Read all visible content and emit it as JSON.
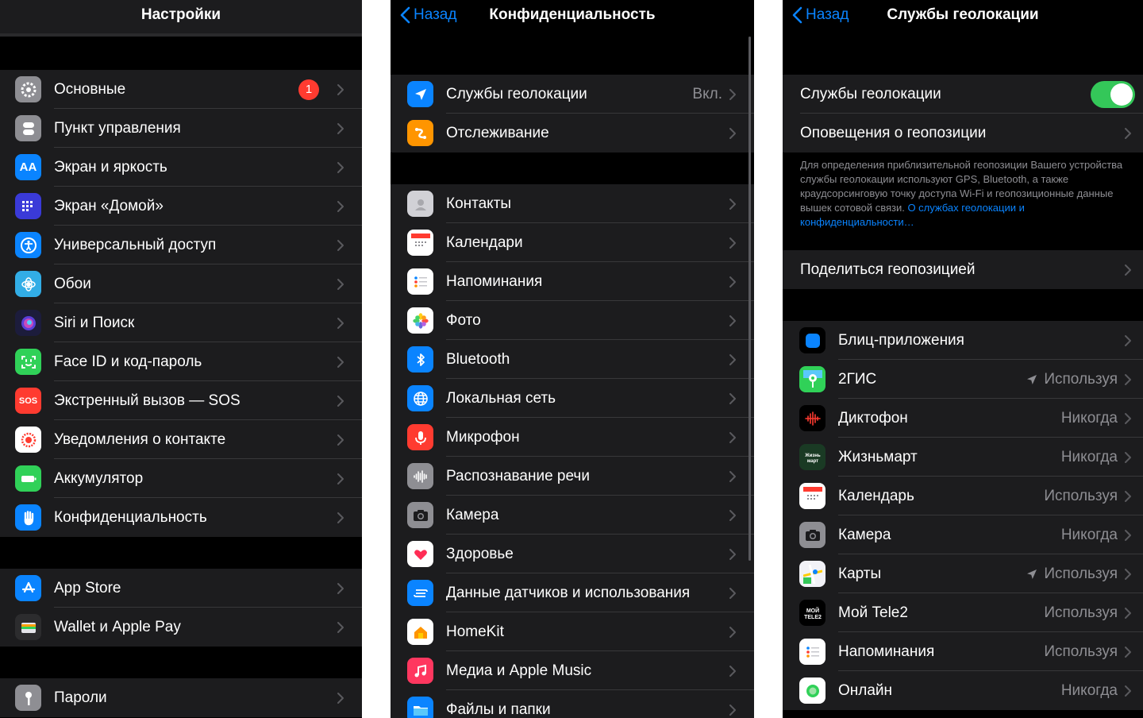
{
  "panel1": {
    "title": "Настройки",
    "group1": [
      {
        "label": "Основные",
        "icon": "gear-icon",
        "badge": "1"
      },
      {
        "label": "Пункт управления",
        "icon": "control-center-icon"
      },
      {
        "label": "Экран и яркость",
        "icon": "display-icon",
        "glyph": "AA"
      },
      {
        "label": "Экран «Домой»",
        "icon": "home-screen-icon"
      },
      {
        "label": "Универсальный доступ",
        "icon": "accessibility-icon"
      },
      {
        "label": "Обои",
        "icon": "wallpaper-icon"
      },
      {
        "label": "Siri и Поиск",
        "icon": "siri-icon"
      },
      {
        "label": "Face ID и код-пароль",
        "icon": "faceid-icon"
      },
      {
        "label": "Экстренный вызов — SOS",
        "icon": "sos-icon",
        "glyph": "SOS"
      },
      {
        "label": "Уведомления о контакте",
        "icon": "exposure-icon"
      },
      {
        "label": "Аккумулятор",
        "icon": "battery-icon"
      },
      {
        "label": "Конфиденциальность",
        "icon": "hand-icon"
      }
    ],
    "group2": [
      {
        "label": "App Store",
        "icon": "app-store-icon"
      },
      {
        "label": "Wallet и Apple Pay",
        "icon": "wallet-icon"
      }
    ],
    "group3": [
      {
        "label": "Пароли",
        "icon": "key-icon"
      }
    ]
  },
  "panel2": {
    "back": "Назад",
    "title": "Конфиденциальность",
    "group1": [
      {
        "label": "Службы геолокации",
        "value": "Вкл.",
        "icon": "location-arrow-icon"
      },
      {
        "label": "Отслеживание",
        "icon": "tracking-icon"
      }
    ],
    "group2": [
      {
        "label": "Контакты",
        "icon": "contacts-icon"
      },
      {
        "label": "Календари",
        "icon": "calendar-icon"
      },
      {
        "label": "Напоминания",
        "icon": "reminders-icon"
      },
      {
        "label": "Фото",
        "icon": "photos-icon"
      },
      {
        "label": "Bluetooth",
        "icon": "bluetooth-icon"
      },
      {
        "label": "Локальная сеть",
        "icon": "globe-icon"
      },
      {
        "label": "Микрофон",
        "icon": "microphone-icon"
      },
      {
        "label": "Распознавание речи",
        "icon": "waveform-icon"
      },
      {
        "label": "Камера",
        "icon": "camera-icon"
      },
      {
        "label": "Здоровье",
        "icon": "health-icon"
      },
      {
        "label": "Данные датчиков и использования",
        "icon": "sensor-icon"
      },
      {
        "label": "HomeKit",
        "icon": "homekit-icon"
      },
      {
        "label": "Медиа и Apple Music",
        "icon": "music-icon"
      },
      {
        "label": "Файлы и папки",
        "icon": "folder-icon"
      }
    ]
  },
  "panel3": {
    "back": "Назад",
    "title": "Службы геолокации",
    "toggle_row": {
      "label": "Службы геолокации",
      "on": true
    },
    "alerts_row": {
      "label": "Оповещения о геопозиции"
    },
    "note": "Для определения приблизительной геопозиции Вашего устройства службы геолокации используют GPS, Bluetooth, а также краудсорсинговую точку доступа Wi-Fi и геопозиционные данные вышек сотовой связи. ",
    "note_link": "О службах геолокации и конфиденциальности…",
    "share_row": {
      "label": "Поделиться геопозицией"
    },
    "apps": [
      {
        "label": "Блиц-приложения",
        "value": "",
        "icon": "app-clips-icon"
      },
      {
        "label": "2ГИС",
        "value": "Используя",
        "icon": "2gis-icon",
        "arrow": true
      },
      {
        "label": "Диктофон",
        "value": "Никогда",
        "icon": "voice-memos-icon"
      },
      {
        "label": "Жизньмарт",
        "value": "Никогда",
        "icon": "zhiznmart-icon"
      },
      {
        "label": "Календарь",
        "value": "Используя",
        "icon": "calendar-icon"
      },
      {
        "label": "Камера",
        "value": "Никогда",
        "icon": "camera-icon"
      },
      {
        "label": "Карты",
        "value": "Используя",
        "icon": "maps-icon",
        "arrow": true
      },
      {
        "label": "Мой Tele2",
        "value": "Используя",
        "icon": "tele2-icon"
      },
      {
        "label": "Напоминания",
        "value": "Используя",
        "icon": "reminders-icon"
      },
      {
        "label": "Онлайн",
        "value": "Никогда",
        "icon": "online-icon"
      }
    ]
  }
}
